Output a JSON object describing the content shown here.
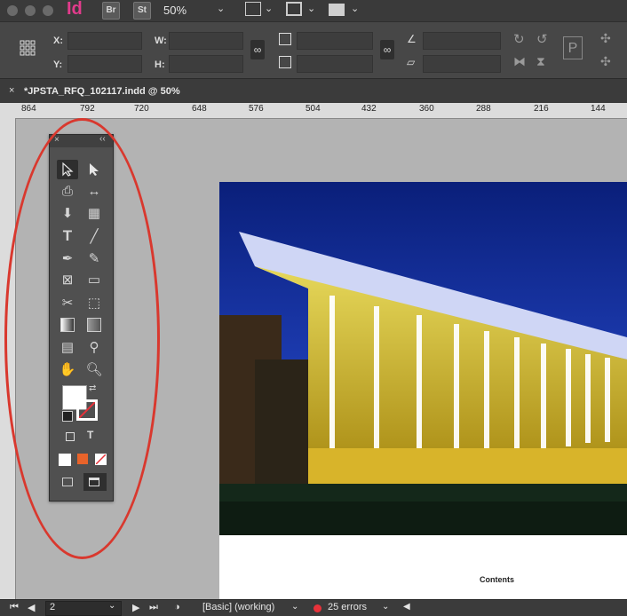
{
  "app": {
    "logo": "Id",
    "bridge_label": "Br",
    "stock_label": "St",
    "zoom": "50%"
  },
  "control_panel": {
    "x_label": "X:",
    "y_label": "Y:",
    "w_label": "W:",
    "h_label": "H:",
    "x_value": "",
    "y_value": "",
    "w_value": "",
    "h_value": ""
  },
  "document": {
    "tab_title": "*JPSTA_RFQ_102117.indd @ 50%",
    "close_glyph": "×"
  },
  "ruler": {
    "labels": [
      "864",
      "792",
      "720",
      "648",
      "576",
      "504",
      "432",
      "360",
      "288",
      "216",
      "144"
    ]
  },
  "page_text": {
    "contents_heading": "Contents"
  },
  "status_bar": {
    "page_number": "2",
    "style": "[Basic] (working)",
    "errors": "25 errors"
  },
  "colors": {
    "accent_annotation": "#d9382e",
    "indesign_brand": "#e23b8c",
    "error_dot": "#e8323a",
    "fill_swatch": "#ffffff",
    "apply_color": "#e8632a"
  },
  "icons": {
    "tools": [
      "selection-tool",
      "direct-selection-tool",
      "page-tool",
      "gap-tool",
      "content-collector-tool",
      "content-placer-tool",
      "type-tool",
      "line-tool",
      "pen-tool",
      "pencil-tool",
      "rectangle-frame-tool",
      "rectangle-tool",
      "scissors-tool",
      "free-transform-tool",
      "gradient-swatch-tool",
      "gradient-feather-tool",
      "note-tool",
      "eyedropper-tool",
      "hand-tool",
      "zoom-tool"
    ]
  }
}
